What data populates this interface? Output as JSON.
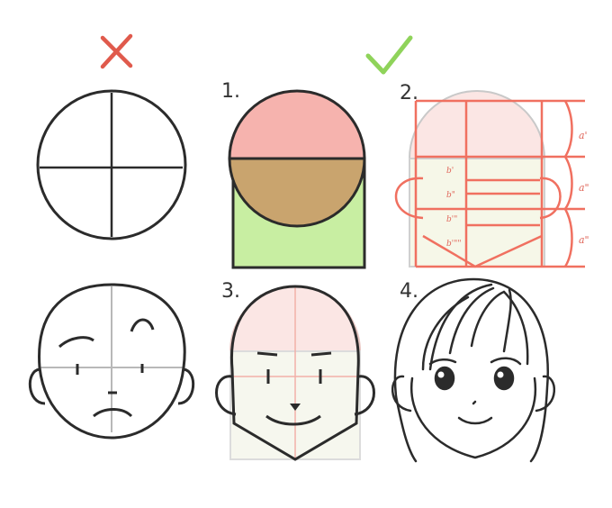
{
  "marks": {
    "wrong": "✗",
    "right": "✓"
  },
  "steps": [
    "1.",
    "2.",
    "3.",
    "4."
  ],
  "measure_labels": {
    "a1": "a'",
    "a2": "a\"",
    "a3": "a\""
  },
  "b_labels": [
    "b'",
    "b\"",
    "b'\"",
    "b'\"\""
  ],
  "colors": {
    "wrong": "#e05a4c",
    "right": "#8fd35a",
    "crown": "#f6b3ae",
    "face": "#c9a46e",
    "jaw": "#c8eea2",
    "guide": "#f07060",
    "ink": "#2b2b2b"
  }
}
